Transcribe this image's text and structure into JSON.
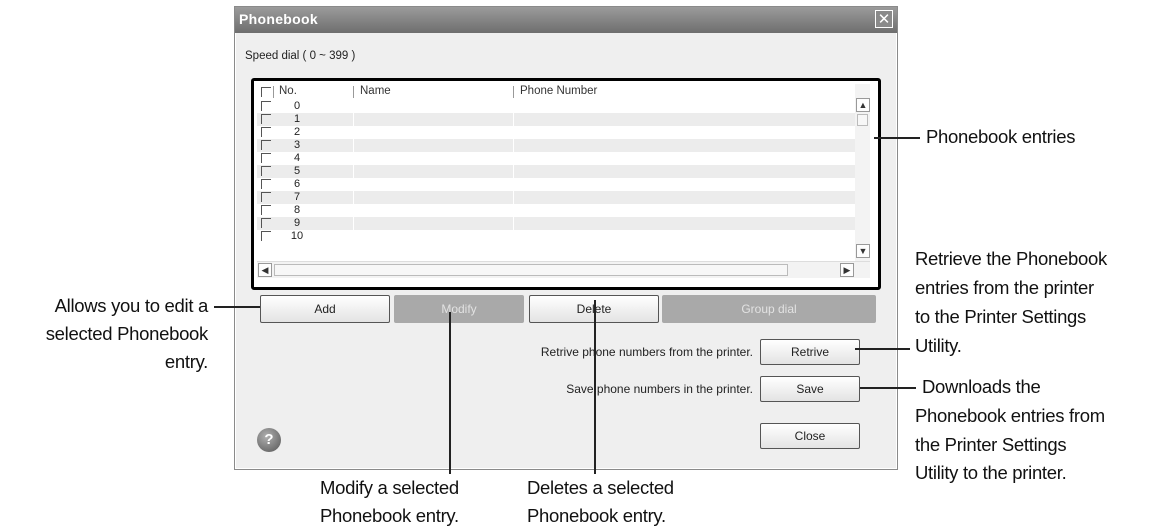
{
  "window": {
    "title": "Phonebook",
    "close_glyph": "✕"
  },
  "speed_dial_label": "Speed dial ( 0 ~ 399 )",
  "table": {
    "columns": [
      "No.",
      "Name",
      "Phone Number"
    ],
    "rows": [
      "0",
      "1",
      "2",
      "3",
      "4",
      "5",
      "6",
      "7",
      "8",
      "9",
      "10"
    ]
  },
  "buttons": {
    "add": "Add",
    "modify": "Modify",
    "delete": "Delete",
    "group_dial": "Group dial",
    "retrieve": "Retrive",
    "save": "Save",
    "close": "Close"
  },
  "labels": {
    "retrieve": "Retrive phone numbers from the printer.",
    "save": "Save phone numbers in the printer."
  },
  "help_glyph": "?",
  "callouts": {
    "phonebook_entries": "Phonebook entries",
    "retrieve_1": "Retrieve the Phonebook",
    "retrieve_2": "entries from the printer",
    "retrieve_3": "to the Printer Settings",
    "retrieve_4": "Utility.",
    "allows_1": "Allows you to edit a",
    "allows_2": "selected Phonebook",
    "allows_3": "entry.",
    "downloads_1": "Downloads the",
    "downloads_2": "Phonebook entries from",
    "downloads_3": "the Printer Settings",
    "downloads_4": "Utility to the printer.",
    "modify_1": "Modify a selected",
    "modify_2": "Phonebook entry.",
    "deletes_1": "Deletes a selected",
    "deletes_2": "Phonebook entry."
  }
}
